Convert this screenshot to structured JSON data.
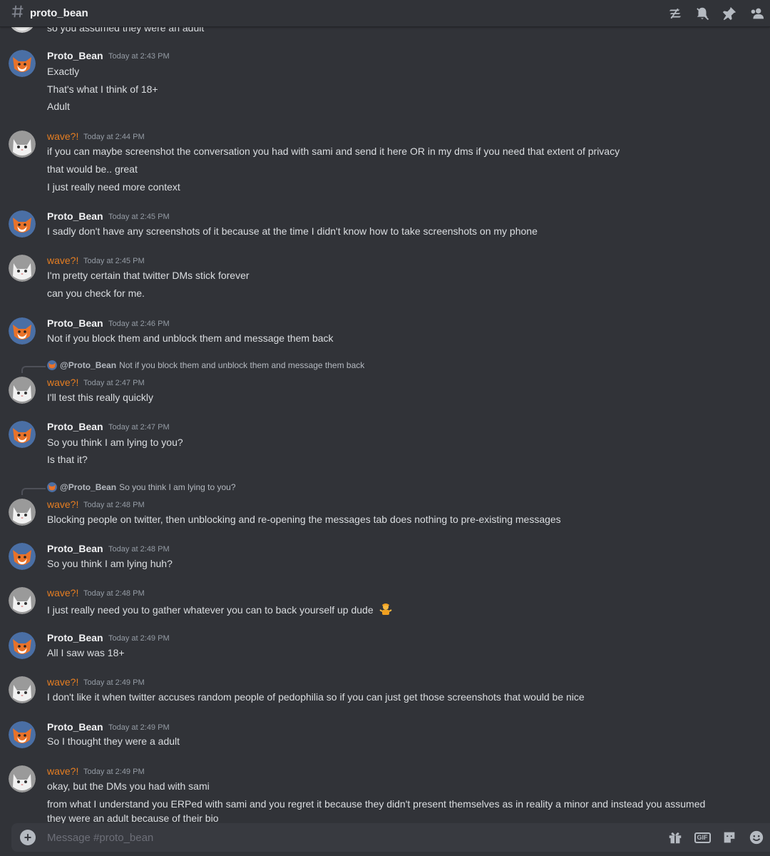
{
  "channel": {
    "name": "proto_bean",
    "placeholder": "Message #proto_bean"
  },
  "header_icons": [
    "threads-icon",
    "notifications-muted-icon",
    "pin-icon",
    "members-icon"
  ],
  "composer_icons": [
    "gift-icon",
    "gif-button",
    "sticker-icon",
    "emoji-icon"
  ],
  "gif_label": "GIF",
  "top_partial_line": "so you assumed they were an adult",
  "users": {
    "proto": {
      "name": "Proto_Bean",
      "color": "#f2f3f5",
      "avatar": "fox-avatar"
    },
    "wave": {
      "name": "wave?!",
      "color": "#e67e22",
      "avatar": "cat-avatar"
    }
  },
  "messages": [
    {
      "user": "Proto_Bean",
      "time": "Today at 2:43 PM",
      "lines": [
        "Exactly",
        "That's what I think of 18+",
        "Adult"
      ]
    },
    {
      "user": "wave?!",
      "time": "Today at 2:44 PM",
      "lines": [
        "if you can maybe screenshot the conversation you had with sami and send it here OR in my dms if you need that extent of privacy",
        "that would be.. great",
        "I just really need more context"
      ]
    },
    {
      "user": "Proto_Bean",
      "time": "Today at 2:45 PM",
      "lines": [
        "I sadly don't have any screenshots of it because at the time I didn't know how to take screenshots on my phone"
      ]
    },
    {
      "user": "wave?!",
      "time": "Today at 2:45 PM",
      "lines": [
        "I'm pretty certain that twitter DMs stick forever",
        "can you check for me."
      ]
    },
    {
      "user": "Proto_Bean",
      "time": "Today at 2:46 PM",
      "lines": [
        "Not if you block them and unblock them and message them back"
      ]
    },
    {
      "user": "wave?!",
      "time": "Today at 2:47 PM",
      "reply": {
        "name": "@Proto_Bean",
        "text": "Not if you block them and unblock them and message them back"
      },
      "lines": [
        "I'll test this really quickly"
      ]
    },
    {
      "user": "Proto_Bean",
      "time": "Today at 2:47 PM",
      "lines": [
        "So you think I am lying to you?",
        "Is that it?"
      ]
    },
    {
      "user": "wave?!",
      "time": "Today at 2:48 PM",
      "reply": {
        "name": "@Proto_Bean",
        "text": "So you think I am lying to you?"
      },
      "lines": [
        "Blocking people on twitter, then unblocking and re-opening the messages tab does nothing to pre-existing messages"
      ]
    },
    {
      "user": "Proto_Bean",
      "time": "Today at 2:48 PM",
      "lines": [
        "So you think I am lying huh?"
      ]
    },
    {
      "user": "wave?!",
      "time": "Today at 2:48 PM",
      "lines": [
        "I just really need you to gather whatever you can to back yourself up dude"
      ],
      "emoji": "person-shrugging-emoji"
    },
    {
      "user": "Proto_Bean",
      "time": "Today at 2:49 PM",
      "lines": [
        "All I saw was 18+"
      ]
    },
    {
      "user": "wave?!",
      "time": "Today at 2:49 PM",
      "lines": [
        "I don't like it when twitter accuses random people of pedophilia so if you can just get those screenshots that would be nice"
      ]
    },
    {
      "user": "Proto_Bean",
      "time": "Today at 2:49 PM",
      "lines": [
        "So I thought they were a adult"
      ]
    },
    {
      "user": "wave?!",
      "time": "Today at 2:49 PM",
      "lines": [
        "okay, but the DMs you had with sami",
        "from what I understand you ERPed with sami and you regret it because they didn't present themselves as in reality a minor and instead you assumed",
        "they were an adult because of their bio"
      ]
    }
  ]
}
